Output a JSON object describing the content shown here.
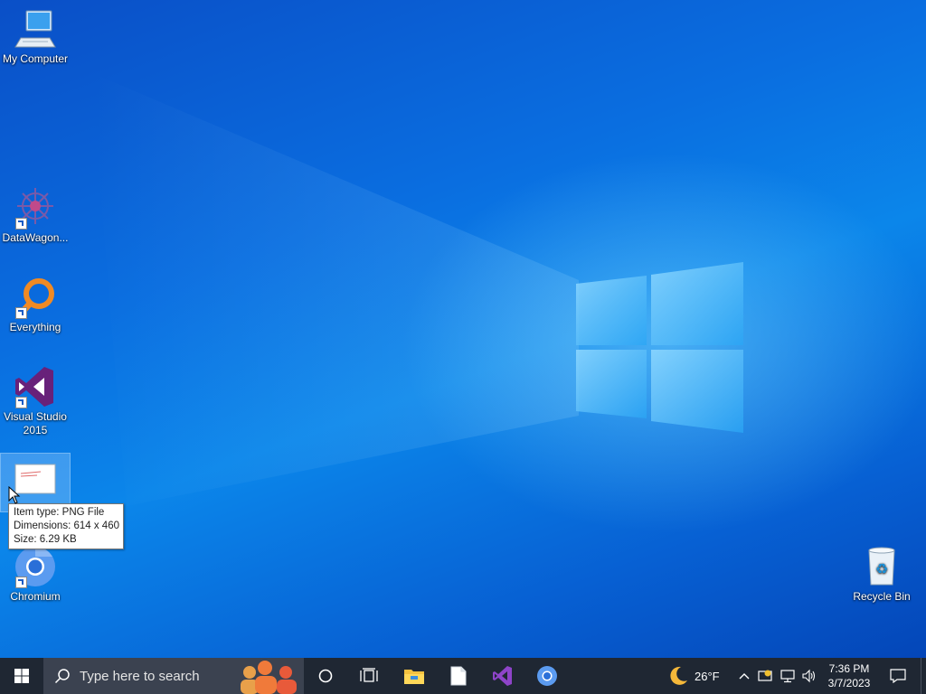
{
  "desktop": {
    "icons": [
      {
        "label": "My Computer"
      },
      {
        "label": "DataWagon..."
      },
      {
        "label": "Everything"
      },
      {
        "label": "Visual Studio 2015"
      },
      {
        "label": ""
      },
      {
        "label": "Chromium"
      },
      {
        "label": "Recycle Bin"
      }
    ],
    "tooltip": {
      "type_line": "Item type: PNG File",
      "dimensions_line": "Dimensions: 614 x 460",
      "size_line": "Size: 6.29 KB"
    }
  },
  "taskbar": {
    "search_placeholder": "Type here to search",
    "pinned": [
      {
        "icon": "task-view-icon"
      },
      {
        "icon": "file-explorer-icon"
      },
      {
        "icon": "notepad-icon"
      },
      {
        "icon": "visual-studio-icon"
      },
      {
        "icon": "chromium-icon"
      }
    ],
    "weather": {
      "temp": "26°F",
      "icon": "moon-icon"
    },
    "clock": {
      "time": "7:36 PM",
      "date": "3/7/2023"
    }
  },
  "colors": {
    "taskbar_bg": "#1f2733",
    "search_bg": "#3b4250",
    "desktop_blue": "#0a6ee0",
    "vs_purple": "#68217a",
    "everything_orange": "#f08a24"
  }
}
